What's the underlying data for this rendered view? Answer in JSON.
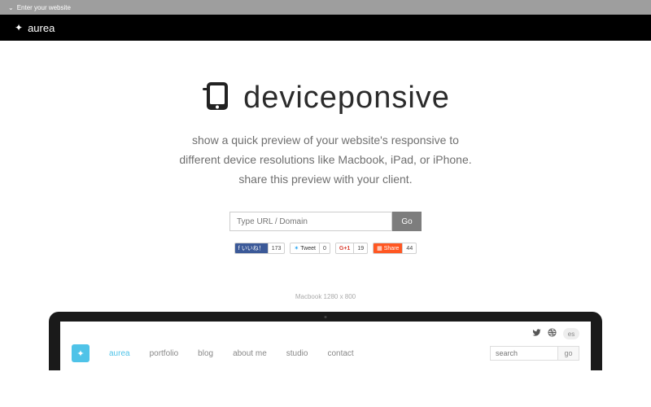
{
  "topbar": {
    "label": "Enter your website"
  },
  "blackbar": {
    "brand": "aurea"
  },
  "hero": {
    "title": "deviceponsive",
    "tagline_l1": "show a quick preview of your website's responsive to",
    "tagline_l2": "different device resolutions like Macbook, iPad, or iPhone.",
    "tagline_l3": "share this preview with your client."
  },
  "url": {
    "placeholder": "Type URL / Domain",
    "go": "Go"
  },
  "social": {
    "fb": {
      "label": "いいね！",
      "count": "173"
    },
    "tw": {
      "label": "Tweet",
      "count": "0"
    },
    "gp": {
      "label": "G+1",
      "count": "19"
    },
    "sh": {
      "label": "Share",
      "count": "44"
    }
  },
  "device_label": "Macbook 1280 x 800",
  "preview": {
    "lang": "es",
    "nav": [
      "aurea",
      "portfolio",
      "blog",
      "about me",
      "studio",
      "contact"
    ],
    "search_placeholder": "search",
    "search_go": "go"
  }
}
